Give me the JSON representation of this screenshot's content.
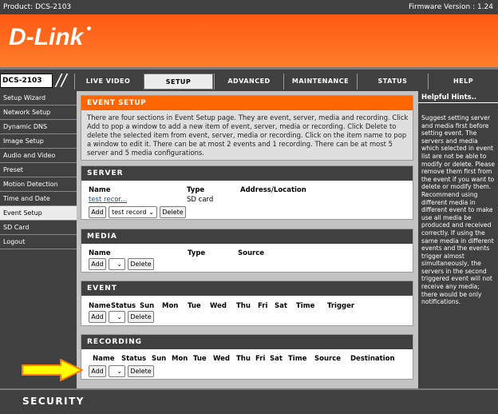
{
  "topbar": {
    "product": "Product: DCS-2103",
    "firmware": "Firmware Version : 1.24"
  },
  "brand": {
    "logo": "D-Link"
  },
  "model": "DCS-2103",
  "nav": {
    "tabs": [
      {
        "label": "LIVE VIDEO"
      },
      {
        "label": "SETUP"
      },
      {
        "label": "ADVANCED"
      },
      {
        "label": "MAINTENANCE"
      },
      {
        "label": "STATUS"
      },
      {
        "label": "HELP"
      }
    ],
    "active_tab": "SETUP"
  },
  "sidebar": {
    "items": [
      {
        "label": "Setup Wizard"
      },
      {
        "label": "Network Setup"
      },
      {
        "label": "Dynamic DNS"
      },
      {
        "label": "Image Setup"
      },
      {
        "label": "Audio and Video"
      },
      {
        "label": "Preset"
      },
      {
        "label": "Motion Detection"
      },
      {
        "label": "Time and Date"
      },
      {
        "label": "Event Setup"
      },
      {
        "label": "SD Card"
      },
      {
        "label": "Logout"
      }
    ],
    "active": "Event Setup"
  },
  "event_setup": {
    "title": "EVENT SETUP",
    "description": "There are four sections in Event Setup page. They are event, server, media and recording. Click Add to pop a window to add a new item of event, server, media or recording. Click Delete to delete the selected item from event, server, media or recording. Click on the item name to pop a window to edit it. There can be at most 2 events and 1 recording. There can be at most 5 server and 5 media configurations."
  },
  "server": {
    "title": "SERVER",
    "columns": [
      "Name",
      "Type",
      "Address/Location"
    ],
    "rows": [
      {
        "name": "test recor...",
        "type": "SD card",
        "address": ""
      }
    ],
    "add_label": "Add",
    "select_value": "test record",
    "delete_label": "Delete"
  },
  "media": {
    "title": "MEDIA",
    "columns": [
      "Name",
      "Type",
      "Source"
    ],
    "add_label": "Add",
    "select_value": "",
    "delete_label": "Delete"
  },
  "event": {
    "title": "EVENT",
    "columns": [
      "Name",
      "Status",
      "Sun",
      "Mon",
      "Tue",
      "Wed",
      "Thu",
      "Fri",
      "Sat",
      "Time",
      "Trigger"
    ],
    "add_label": "Add",
    "select_value": "",
    "delete_label": "Delete"
  },
  "recording": {
    "title": "RECORDING",
    "columns": [
      "Name",
      "Status",
      "Sun",
      "Mon",
      "Tue",
      "Wed",
      "Thu",
      "Fri",
      "Sat",
      "Time",
      "Source",
      "Destination"
    ],
    "add_label": "Add",
    "select_value": "",
    "delete_label": "Delete"
  },
  "hints": {
    "title": "Helpful Hints..",
    "body": "Suggest setting server and media first before setting event. The servers and media which selected in event list are not be able to modify or delete. Please remove them first from the event if you want to delete or modify them. Recommend using different media in different event to make use all media be produced and received correctly. If using the same media in different events and the events trigger almost simultaneously, the servers in the second triggered event will not receive any media; there would be only notifications."
  },
  "footer": {
    "label": "SECURITY"
  },
  "colors": {
    "brand_orange": "#ff6600",
    "dark_gray": "#404040",
    "panel_gray": "#c3c3c3",
    "arrow_yellow": "#ffff00",
    "arrow_outline": "#ff7a00"
  },
  "icons": {
    "select_chevron": "chevron-down-icon",
    "annotation": "arrow-right-icon"
  }
}
